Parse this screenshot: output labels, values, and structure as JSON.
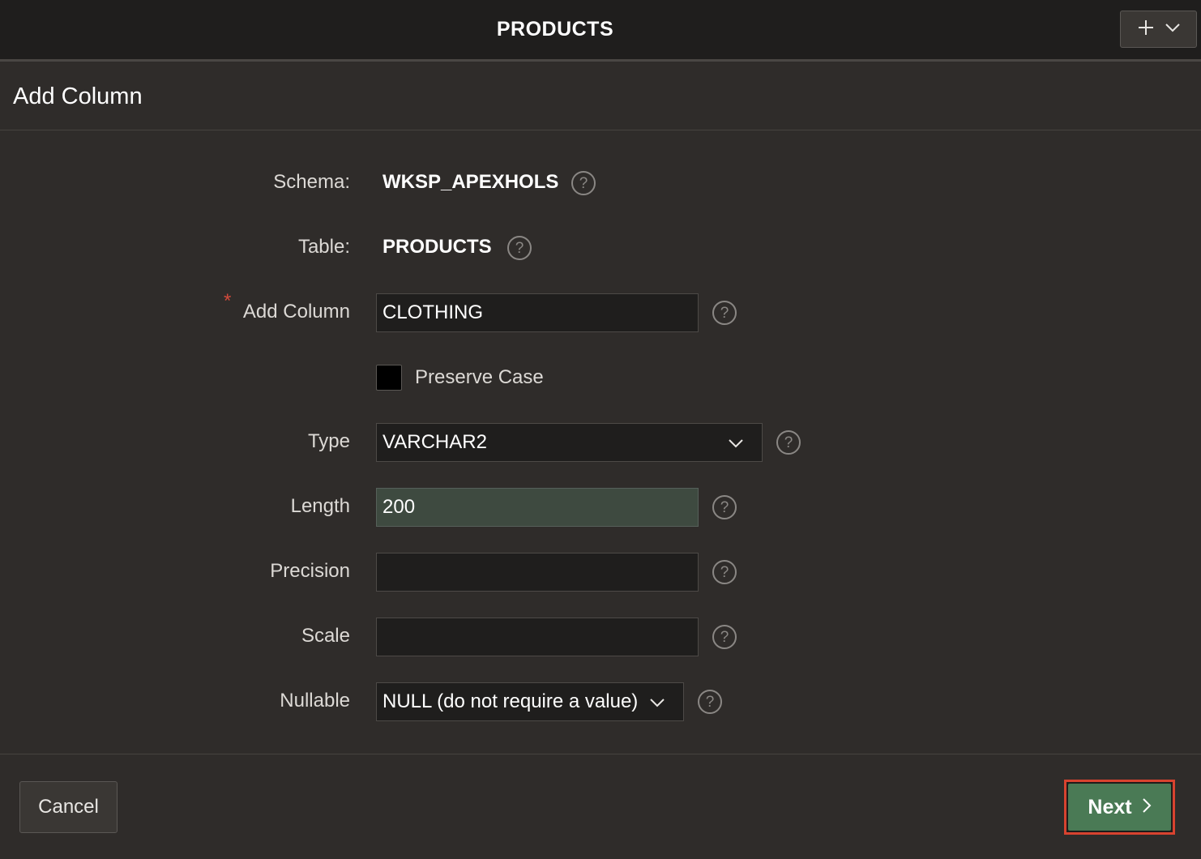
{
  "topbar": {
    "title": "PRODUCTS"
  },
  "dialog": {
    "title": "Add Column"
  },
  "form": {
    "schema_label": "Schema:",
    "schema_value": "WKSP_APEXHOLS",
    "table_label": "Table:",
    "table_value": "PRODUCTS",
    "required_marker": "*",
    "column_label": "Add Column",
    "column_value": "CLOTHING",
    "preserve_case_label": "Preserve Case",
    "preserve_case_checked": false,
    "type_label": "Type",
    "type_value": "VARCHAR2",
    "length_label": "Length",
    "length_value": "200",
    "precision_label": "Precision",
    "precision_value": "",
    "scale_label": "Scale",
    "scale_value": "",
    "nullable_label": "Nullable",
    "nullable_value": "NULL (do not require a value)",
    "help_glyph": "?"
  },
  "footer": {
    "cancel_label": "Cancel",
    "next_label": "Next"
  },
  "colors": {
    "background": "#2f2c2a",
    "topbar": "#1f1e1d",
    "next_button": "#4a7a55",
    "highlight_border": "#d8432f",
    "required_star": "#d24a3b"
  },
  "icons": {
    "topbar_add": "plus-icon",
    "topbar_menu": "chevron-down-icon",
    "help": "help-icon",
    "select_arrow": "chevron-down-icon",
    "next_arrow": "chevron-right-icon"
  }
}
